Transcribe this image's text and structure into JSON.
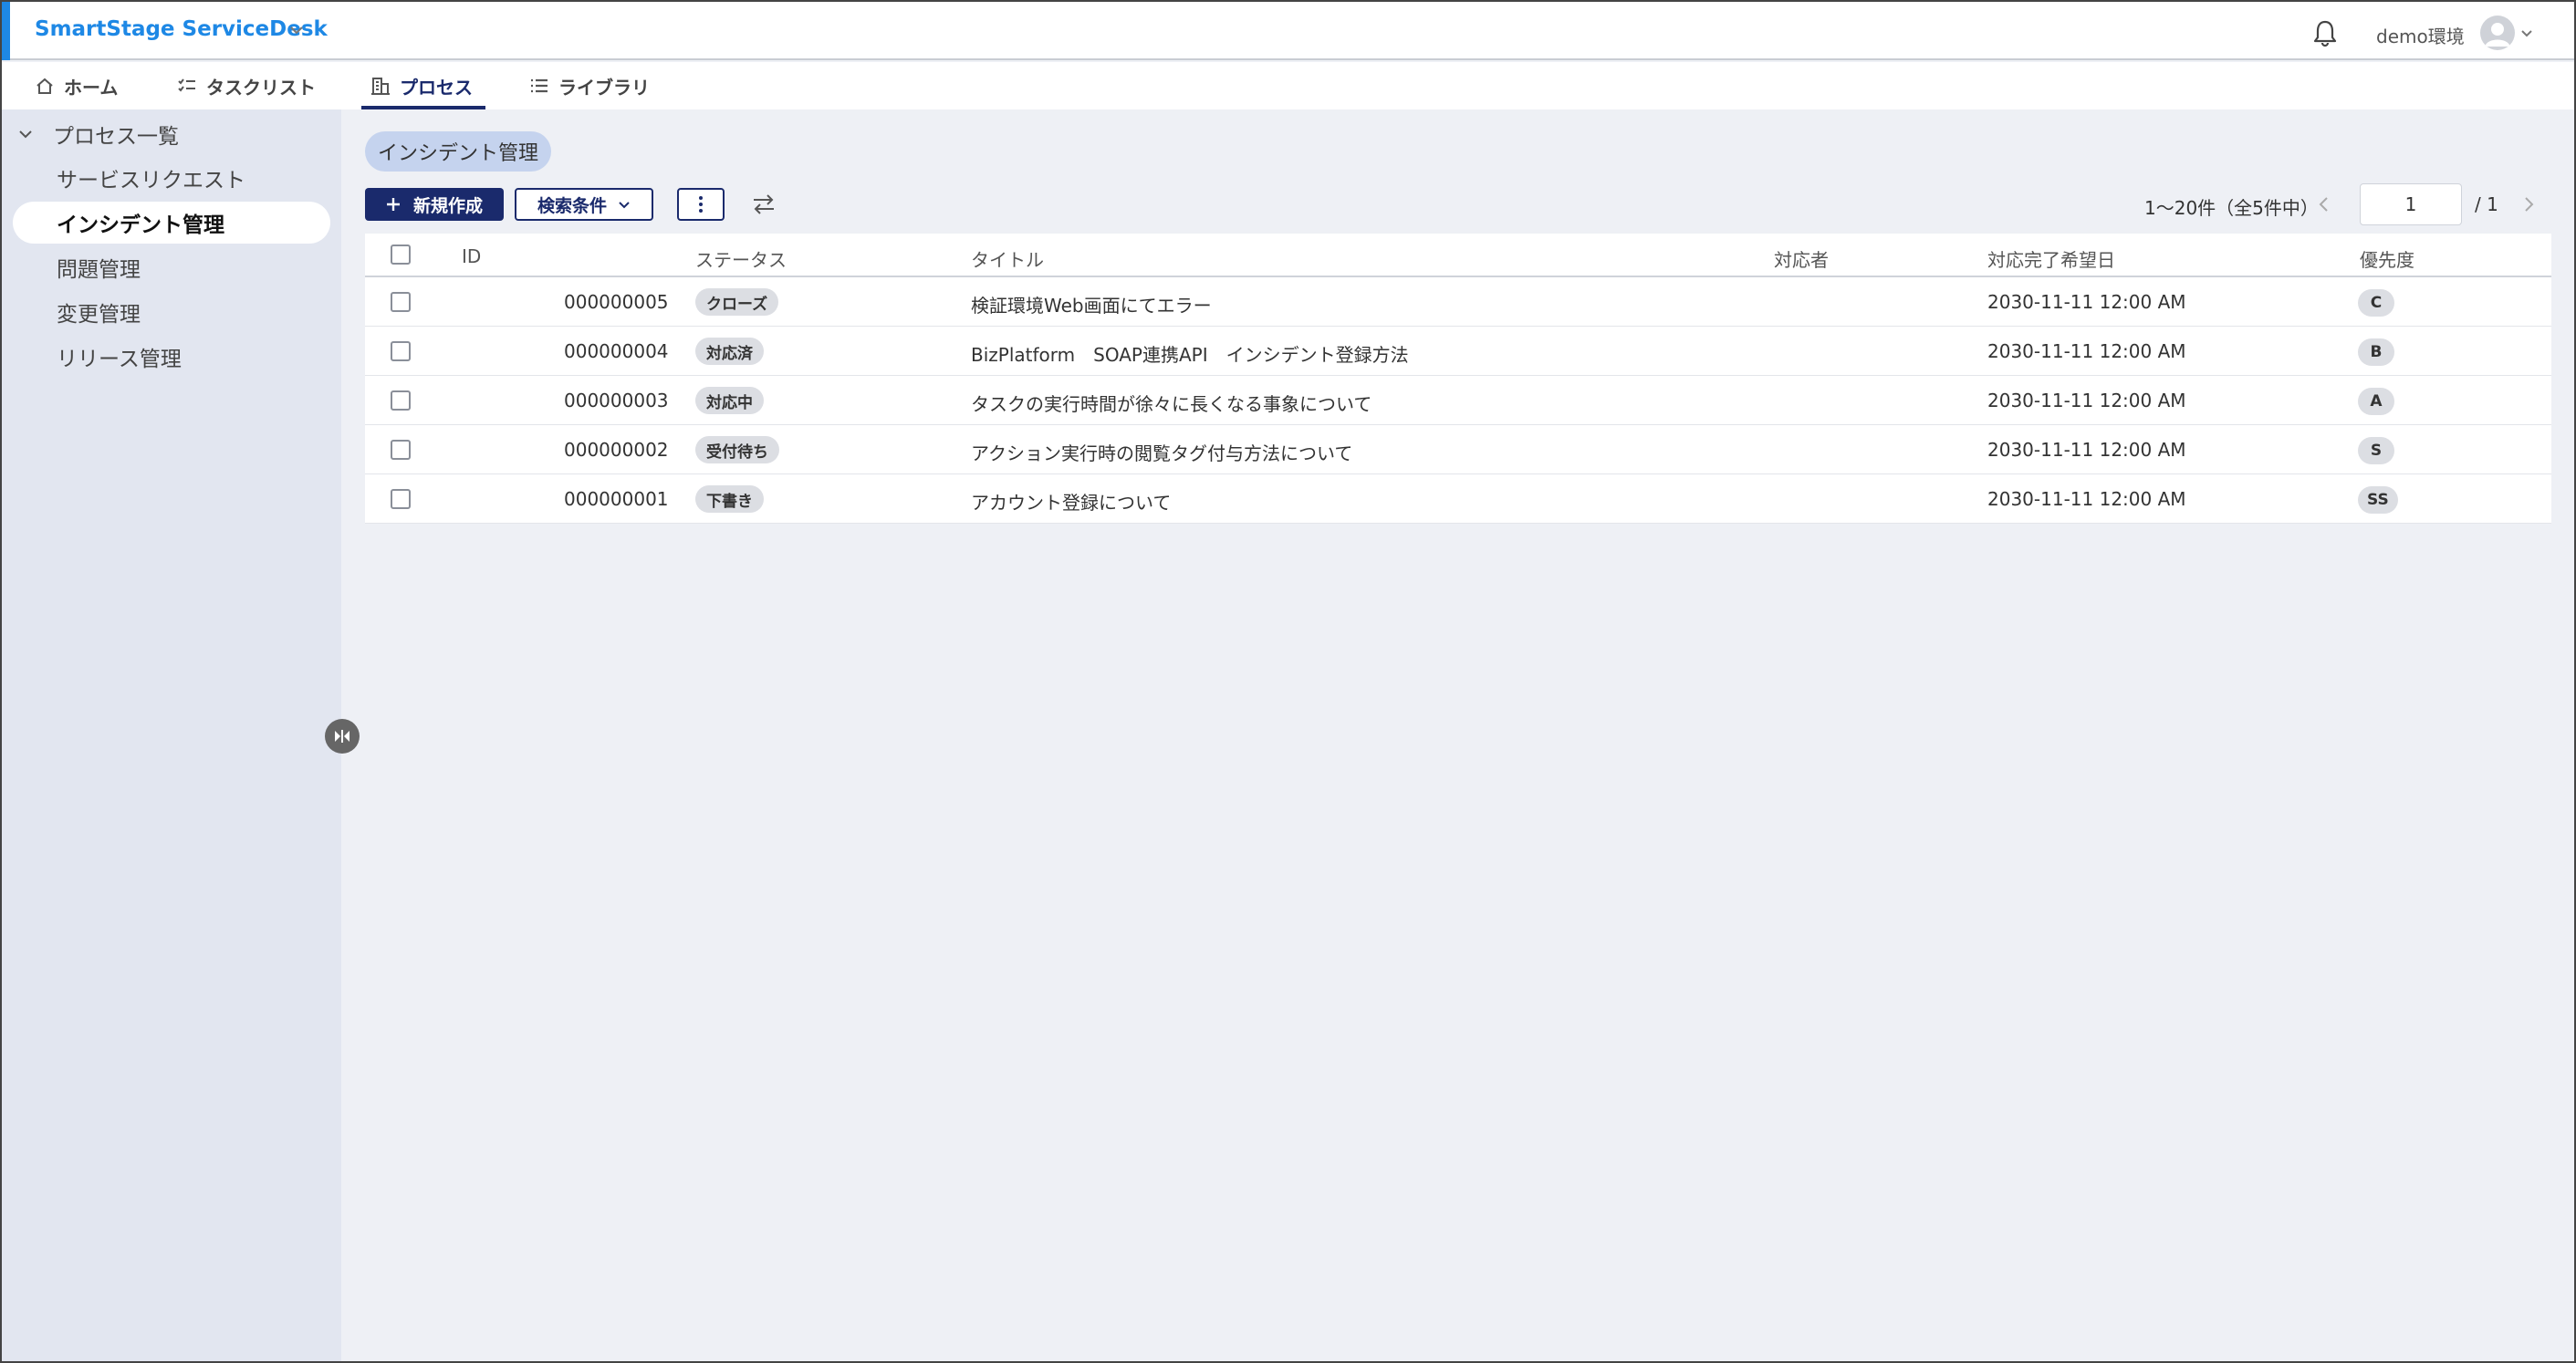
{
  "header": {
    "app_title": "SmartStage ServiceDesk",
    "environment": "demo環境",
    "colors": {
      "accent": "#1e88e5",
      "primary": "#1a2a6c"
    }
  },
  "tabs": [
    {
      "label": "ホーム",
      "icon": "home-icon"
    },
    {
      "label": "タスクリスト",
      "icon": "checklist-icon"
    },
    {
      "label": "プロセス",
      "icon": "building-icon",
      "active": true
    },
    {
      "label": "ライブラリ",
      "icon": "list-icon"
    }
  ],
  "sidebar": {
    "group_label": "プロセス一覧",
    "items": [
      {
        "label": "サービスリクエスト"
      },
      {
        "label": "インシデント管理",
        "active": true
      },
      {
        "label": "問題管理"
      },
      {
        "label": "変更管理"
      },
      {
        "label": "リリース管理"
      }
    ]
  },
  "main": {
    "breadcrumb": "インシデント管理",
    "toolbar": {
      "new_label": "新規作成",
      "search_label": "検索条件"
    },
    "pager": {
      "info": "1〜20件（全5件中）",
      "current_page": "1",
      "total": "/ 1"
    },
    "table": {
      "headers": {
        "id": "ID",
        "status": "ステータス",
        "title": "タイトル",
        "assignee": "対応者",
        "due": "対応完了希望日",
        "priority": "優先度"
      },
      "rows": [
        {
          "id": "000000005",
          "status": "クローズ",
          "title": "検証環境Web画面にてエラー",
          "assignee": "",
          "due": "2030-11-11 12:00 AM",
          "priority": "C"
        },
        {
          "id": "000000004",
          "status": "対応済",
          "title": "BizPlatform　SOAP連携API　インシデント登録方法",
          "assignee": "",
          "due": "2030-11-11 12:00 AM",
          "priority": "B"
        },
        {
          "id": "000000003",
          "status": "対応中",
          "title": "タスクの実行時間が徐々に長くなる事象について",
          "assignee": "",
          "due": "2030-11-11 12:00 AM",
          "priority": "A"
        },
        {
          "id": "000000002",
          "status": "受付待ち",
          "title": "アクション実行時の閲覧タグ付与方法について",
          "assignee": "",
          "due": "2030-11-11 12:00 AM",
          "priority": "S"
        },
        {
          "id": "000000001",
          "status": "下書き",
          "title": "アカウント登録について",
          "assignee": "",
          "due": "2030-11-11 12:00 AM",
          "priority": "SS"
        }
      ]
    }
  }
}
